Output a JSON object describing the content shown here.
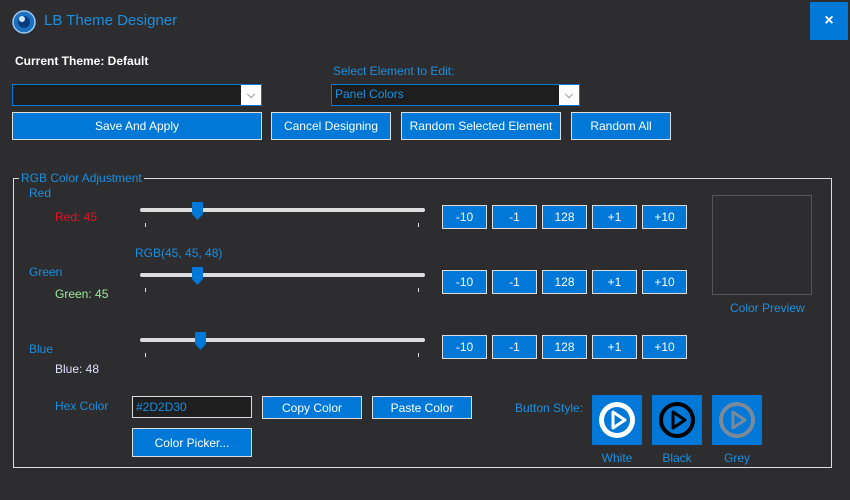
{
  "window": {
    "title": "LB Theme Designer",
    "close_glyph": "×"
  },
  "header": {
    "current_theme": "Current Theme: Default",
    "theme_combo_value": "",
    "select_element_label": "Select Element to Edit:",
    "element_combo_value": "Panel Colors",
    "combo_arrow": "⌵"
  },
  "actions": {
    "save": "Save And Apply",
    "cancel": "Cancel Designing",
    "random_selected": "Random Selected Element",
    "random_all": "Random All"
  },
  "rgb_group": {
    "title": "RGB Color Adjustment",
    "rgb_readout": "RGB(45, 45, 48)",
    "channels": [
      {
        "label": "Red",
        "value_text": "Red: 45",
        "value": 45,
        "value_color": "#e81123"
      },
      {
        "label": "Green",
        "value_text": "Green: 45",
        "value": 45,
        "value_color": "#9ee89e"
      },
      {
        "label": "Blue",
        "value_text": "Blue: 48",
        "value": 48,
        "value_color": "#e0e0ff"
      }
    ],
    "step_buttons": [
      "-10",
      "-1",
      "128",
      "+1",
      "+10"
    ],
    "slider_max": 255
  },
  "preview": {
    "label": "Color Preview",
    "color": "#2D2D30"
  },
  "hex": {
    "label": "Hex Color",
    "value": "#2D2D30",
    "copy": "Copy Color",
    "paste": "Paste Color",
    "picker": "Color Picker..."
  },
  "button_style": {
    "label": "Button Style:",
    "options": [
      {
        "name": "White",
        "icon": "play-circle-icon"
      },
      {
        "name": "Black",
        "icon": "play-circle-icon"
      },
      {
        "name": "Grey",
        "icon": "play-circle-icon"
      }
    ]
  },
  "colors": {
    "accent": "#0078d7",
    "background": "#2d2d30",
    "label_blue": "#1a8fe0"
  }
}
